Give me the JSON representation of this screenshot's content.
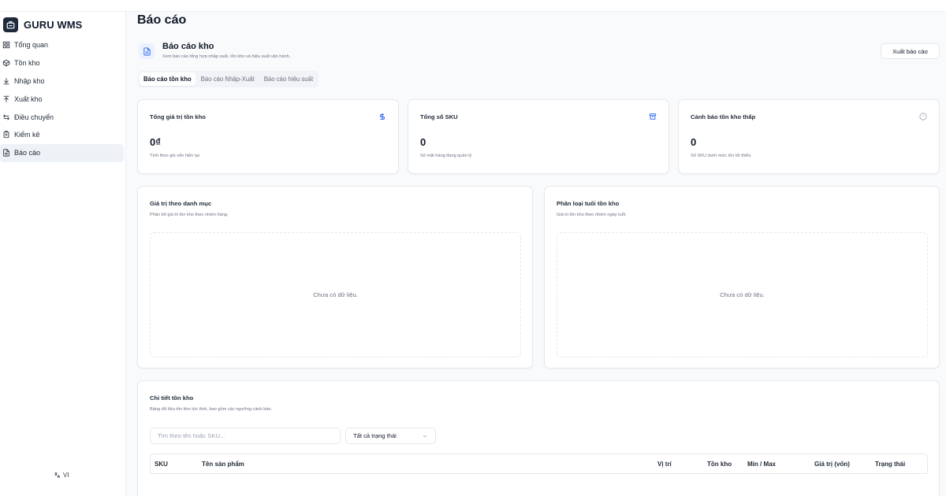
{
  "app": {
    "brand": "GURU WMS",
    "language": "VI"
  },
  "sidebar": {
    "items": [
      {
        "label": "Tổng quan",
        "icon": "grid-icon"
      },
      {
        "label": "Tồn kho",
        "icon": "package-icon"
      },
      {
        "label": "Nhập kho",
        "icon": "download-icon"
      },
      {
        "label": "Xuất kho",
        "icon": "upload-icon"
      },
      {
        "label": "Điều chuyển",
        "icon": "transfer-icon"
      },
      {
        "label": "Kiểm kê",
        "icon": "clipboard-icon"
      },
      {
        "label": "Báo cáo",
        "icon": "report-icon",
        "active": true
      }
    ]
  },
  "page": {
    "title": "Báo cáo",
    "header": {
      "title": "Báo cáo kho",
      "subtitle": "Xem báo cáo tổng hợp nhập xuất, tồn kho và hiệu suất vận hành.",
      "export_label": "Xuất báo cáo"
    },
    "tabs": [
      {
        "label": "Báo cáo tồn kho",
        "active": true
      },
      {
        "label": "Báo cáo Nhập-Xuất",
        "active": false
      },
      {
        "label": "Báo cáo hiệu suất",
        "active": false
      }
    ]
  },
  "stats": [
    {
      "label": "Tổng giá trị tồn kho",
      "value": "0₫",
      "sub": "Tính theo giá vốn hiện tại",
      "icon": "dollar-icon",
      "icon_color": "#2563eb"
    },
    {
      "label": "Tổng số SKU",
      "value": "0",
      "sub": "Số mặt hàng đang quản lý",
      "icon": "archive-icon",
      "icon_color": "#2563eb"
    },
    {
      "label": "Cảnh báo tồn kho thấp",
      "value": "0",
      "sub": "Số SKU dưới mức tồn tối thiểu",
      "icon": "alert-circle-icon",
      "icon_color": "#9ca3af"
    }
  ],
  "panels": [
    {
      "title": "Giá trị theo danh mục",
      "subtitle": "Phân bổ giá trị tồn kho theo nhóm hàng.",
      "empty": "Chưa có dữ liệu."
    },
    {
      "title": "Phân loại tuổi tồn kho",
      "subtitle": "Giá trị tồn kho theo nhóm ngày tuổi.",
      "empty": "Chưa có dữ liệu."
    }
  ],
  "details": {
    "title": "Chi tiết tồn kho",
    "subtitle": "Bảng dữ liệu tồn kho tức thời, bao gồm các ngưỡng cảnh báo.",
    "search_placeholder": "Tìm theo tên hoặc SKU...",
    "status_filter": "Tất cả trạng thái",
    "columns": [
      "SKU",
      "Tên sản phẩm",
      "Vị trí",
      "Tồn kho",
      "Min / Max",
      "Giá trị (vốn)",
      "Trạng thái"
    ]
  },
  "colors": {
    "accent": "#2563eb",
    "sidebar_active": "#eef2f6",
    "brand_logo": "#1e293b"
  }
}
